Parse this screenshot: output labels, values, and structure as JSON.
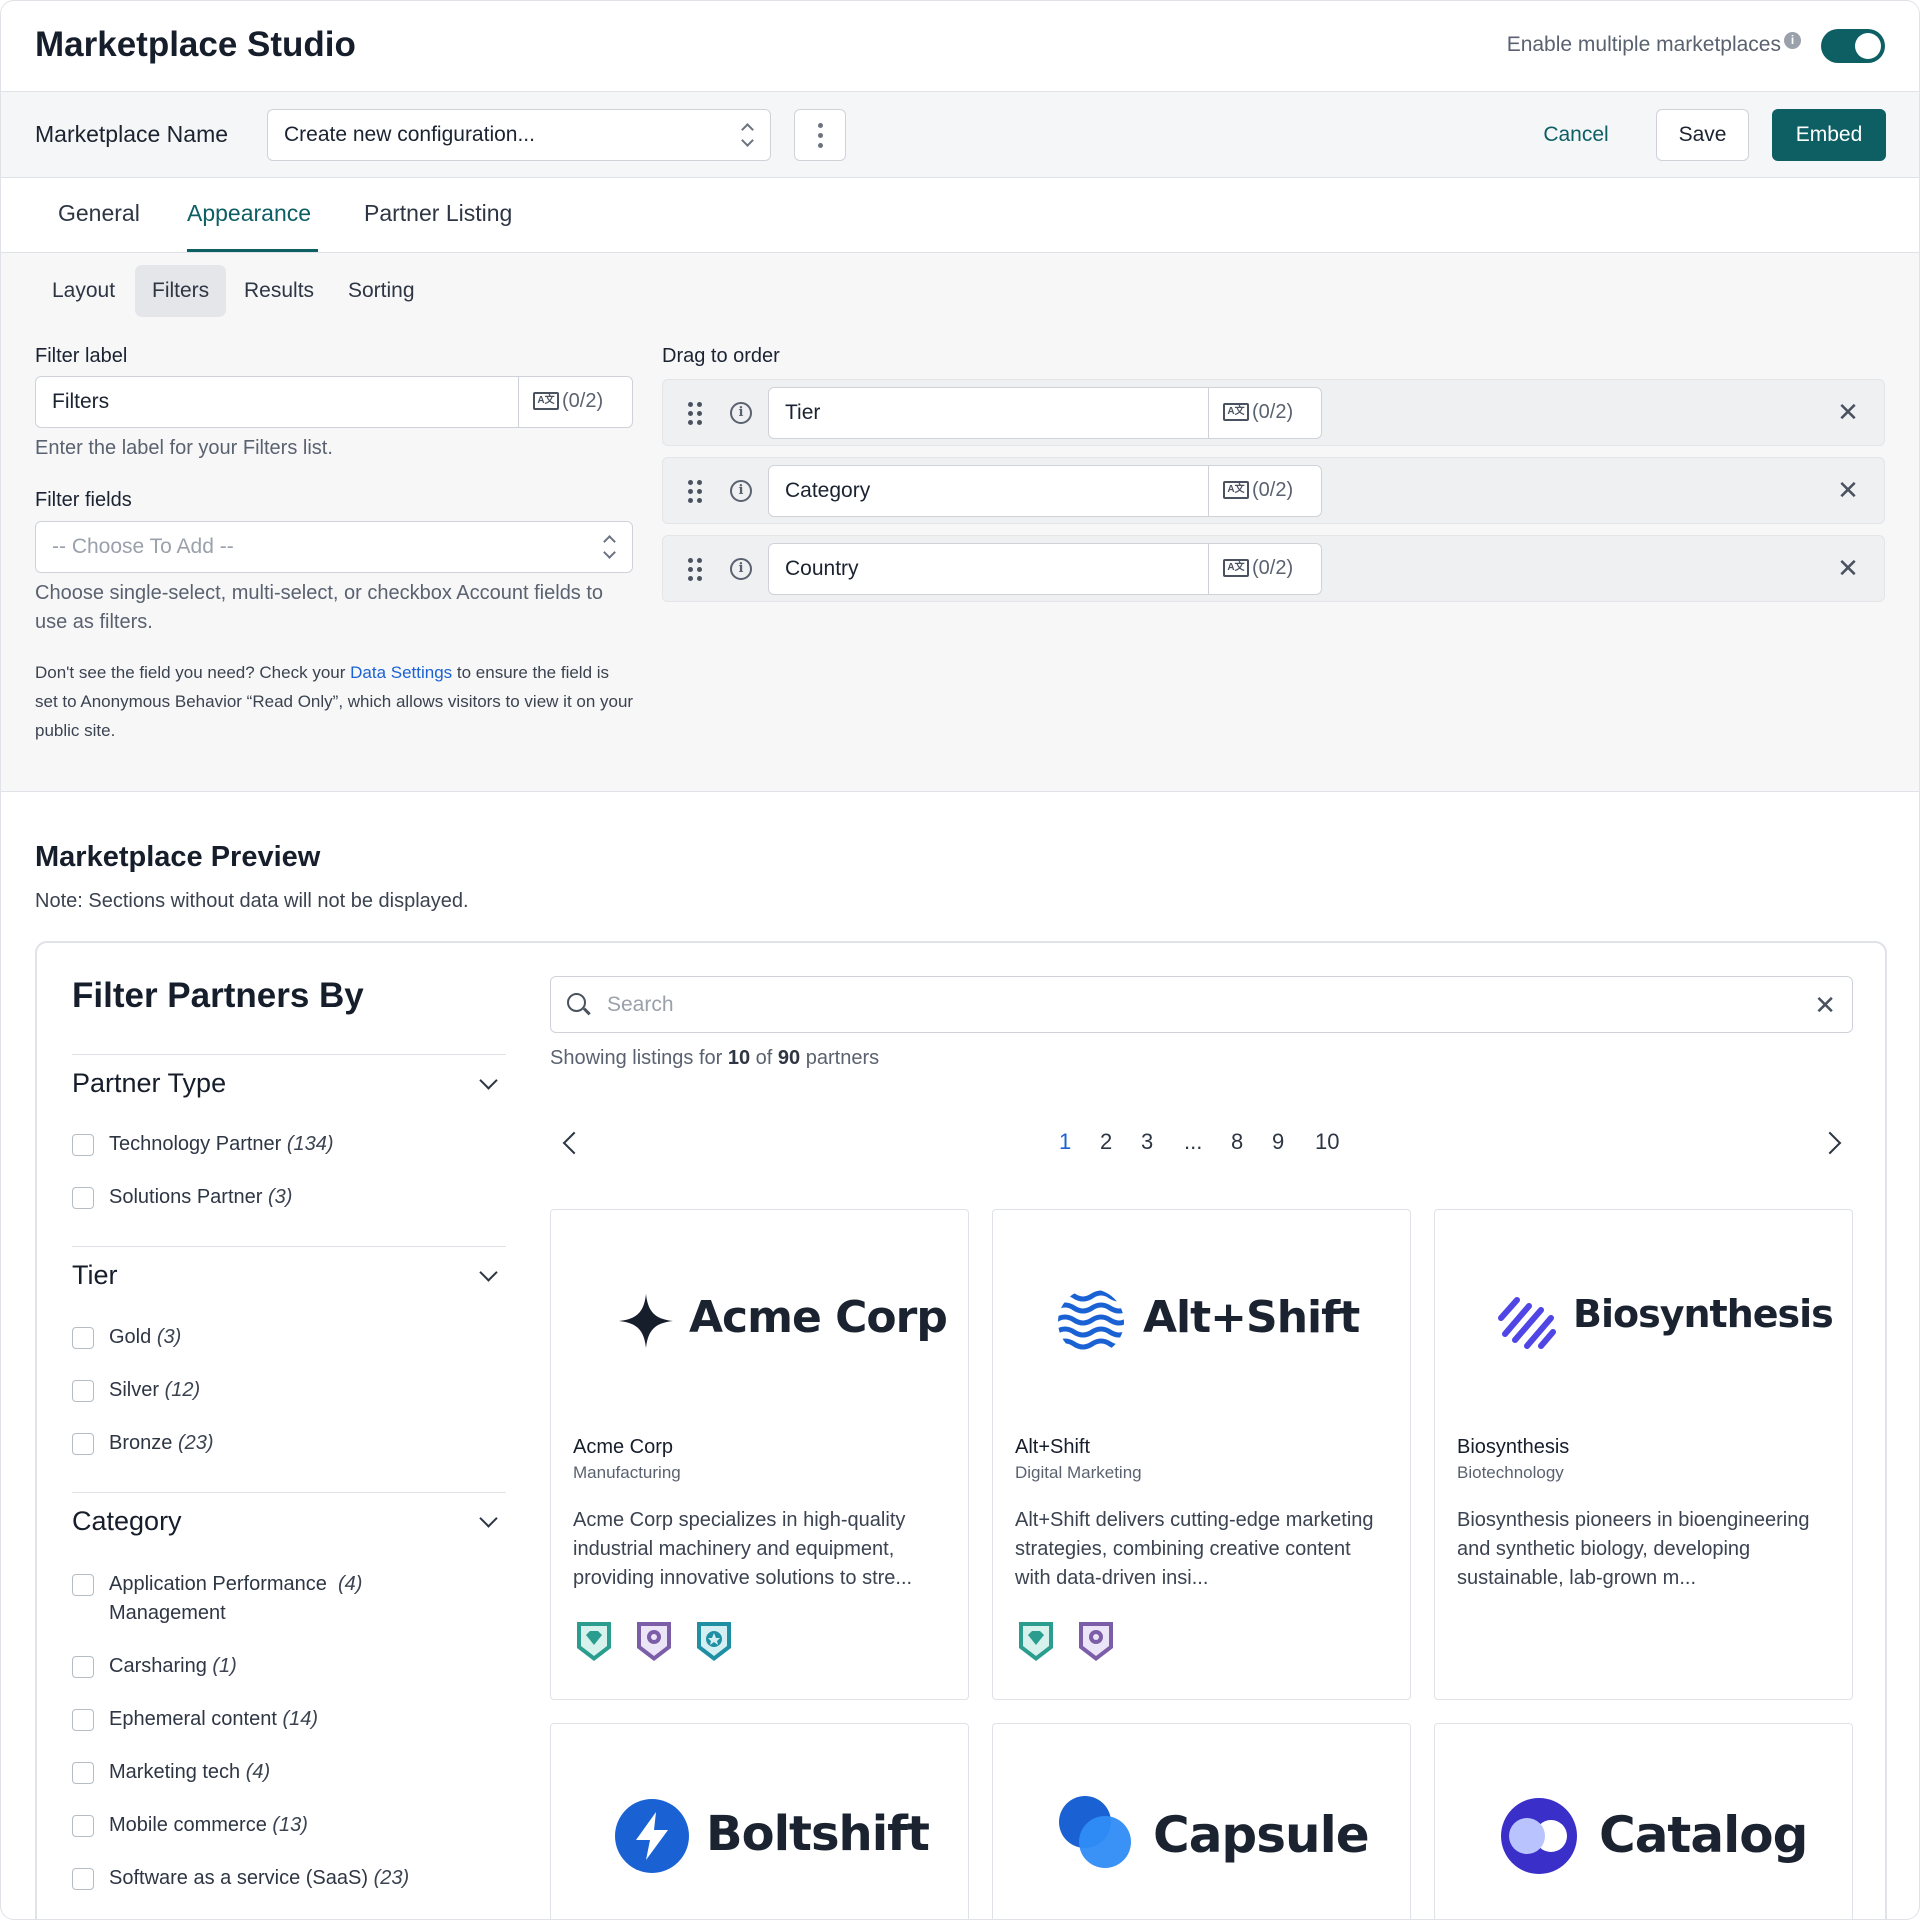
{
  "header": {
    "title": "Marketplace Studio",
    "multi_label": "Enable multiple marketplaces",
    "info_glyph": "i",
    "toggle_on": true
  },
  "config": {
    "name_label": "Marketplace Name",
    "select_value": "Create new configuration...",
    "cancel": "Cancel",
    "save": "Save",
    "embed": "Embed"
  },
  "tabs": [
    "General",
    "Appearance",
    "Partner Listing"
  ],
  "active_tab": "Appearance",
  "subtabs": [
    "Layout",
    "Filters",
    "Results",
    "Sorting"
  ],
  "active_subtab": "Filters",
  "filter_label": {
    "label": "Filter label",
    "value": "Filters",
    "trans_count": "(0/2)",
    "help": "Enter the label for your Filters list."
  },
  "filter_fields": {
    "label": "Filter fields",
    "placeholder": "-- Choose To Add --",
    "help": "Choose single-select, multi-select, or checkbox Account fields to use as filters.",
    "note_pre": "Don't see the field you need? Check your ",
    "note_link": "Data Settings",
    "note_post": " to ensure the field is set to Anonymous Behavior “Read Only”, which allows visitors to view it on your public site."
  },
  "drag_order": {
    "label": "Drag to order",
    "items": [
      {
        "value": "Tier",
        "trans_count": "(0/2)"
      },
      {
        "value": "Category",
        "trans_count": "(0/2)"
      },
      {
        "value": "Country",
        "trans_count": "(0/2)"
      }
    ]
  },
  "preview": {
    "title": "Marketplace Preview",
    "note": "Note: Sections without data will not be displayed.",
    "filter_title": "Filter Partners By",
    "groups": [
      {
        "name": "Partner Type",
        "options": [
          {
            "label": "Technology Partner",
            "count": "(134)"
          },
          {
            "label": "Solutions Partner",
            "count": "(3)"
          }
        ]
      },
      {
        "name": "Tier",
        "options": [
          {
            "label": "Gold",
            "count": "(3)"
          },
          {
            "label": "Silver",
            "count": "(12)"
          },
          {
            "label": "Bronze",
            "count": "(23)"
          }
        ]
      },
      {
        "name": "Category",
        "options": [
          {
            "label": "Application Performance",
            "label2": "Management",
            "count": "(4)"
          },
          {
            "label": "Carsharing",
            "count": "(1)"
          },
          {
            "label": "Ephemeral content",
            "count": "(14)"
          },
          {
            "label": "Marketing tech",
            "count": "(4)"
          },
          {
            "label": "Mobile commerce",
            "count": "(13)"
          },
          {
            "label": "Software as a service (SaaS)",
            "count": "(23)"
          }
        ]
      }
    ],
    "search_placeholder": "Search",
    "showing": {
      "pre": "Showing listings for ",
      "shown": "10",
      "mid": " of ",
      "total": "90",
      "post": " partners"
    },
    "pages": [
      "1",
      "2",
      "3",
      "...",
      "8",
      "9",
      "10"
    ],
    "current_page": "1",
    "cards": [
      {
        "logo": "Acme Corp",
        "name": "Acme Corp",
        "category": "Manufacturing",
        "desc": "Acme Corp specializes in high-quality industrial machinery and equipment, providing innovative solutions to stre...",
        "badges": [
          "diamond-badge-icon",
          "award-badge-icon",
          "star-medal-badge-icon"
        ]
      },
      {
        "logo": "Alt+Shift",
        "name": "Alt+Shift",
        "category": "Digital Marketing",
        "desc": "Alt+Shift delivers cutting-edge marketing strategies, combining creative content with data-driven insi...",
        "badges": [
          "diamond-badge-icon",
          "award-badge-icon"
        ]
      },
      {
        "logo": "Biosynthesis",
        "name": "Biosynthesis",
        "category": "Biotechnology",
        "desc": "Biosynthesis pioneers in bioengineering and synthetic biology, developing sustainable, lab-grown m...",
        "badges": []
      },
      {
        "logo": "Boltshift"
      },
      {
        "logo": "Capsule"
      },
      {
        "logo": "Catalog"
      }
    ]
  },
  "colors": {
    "brand": "#0d5f64",
    "link": "#1a62d4",
    "badge_teal": "#2a9d8f",
    "badge_purple": "#7b5ea7"
  }
}
